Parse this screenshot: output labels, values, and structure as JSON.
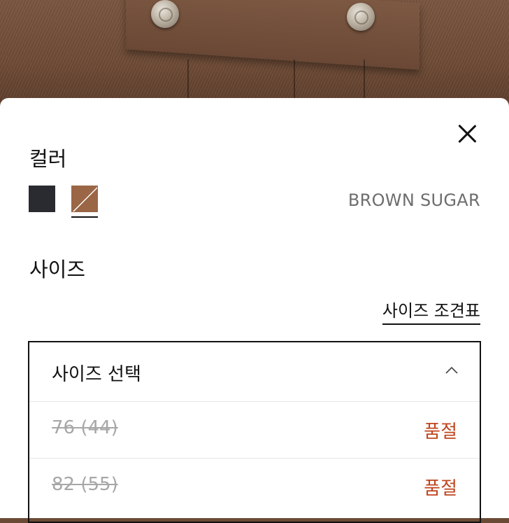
{
  "colors": {
    "accent_soldout": "#c0451e",
    "swatch_black": "#2a2b30",
    "swatch_brown": "#9a6646"
  },
  "close_icon": "close-icon",
  "color_section": {
    "title": "컬러",
    "selected_name": "BROWN SUGAR"
  },
  "size_section": {
    "title": "사이즈",
    "size_guide_link": "사이즈 조견표",
    "dropdown": {
      "placeholder": "사이즈 선택",
      "chevron_icon": "chevron-up-icon",
      "options": [
        {
          "label": "76 (44)",
          "status": "품절"
        },
        {
          "label": "82 (55)",
          "status": "품절"
        }
      ]
    }
  }
}
